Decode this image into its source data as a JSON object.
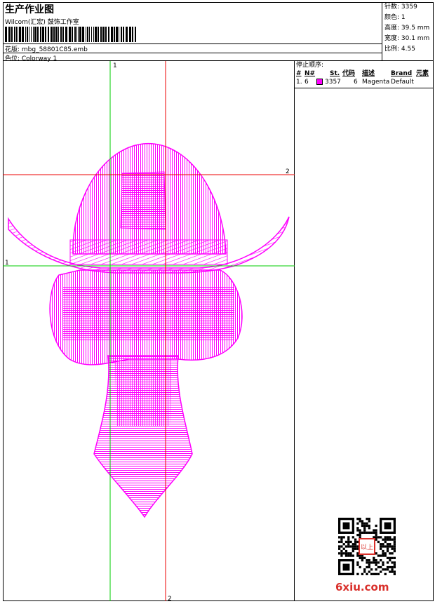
{
  "header": {
    "title": "生产作业图",
    "company": "Wilcom(汇宏) 鼓饰工作室",
    "file_line": "花版: mbg_58801C85.emb",
    "colorway_line": "色位: Colorway 1"
  },
  "stats": {
    "stitches": "针数: 3359",
    "colors": "颜色: 1",
    "height": "高度: 39.5 mm",
    "width": "宽度: 30.1 mm",
    "ratio": "比例: 4.55"
  },
  "design": {
    "marker_top": "1",
    "marker_left": "1",
    "marker_right": "2",
    "marker_bottom": "2",
    "thread_color": "#ff00ff",
    "axis_green": "#00cc00",
    "axis_red": "#ee0000"
  },
  "stop_sequence": {
    "title": "停止顺序:",
    "headers": [
      "#",
      "N#",
      "St.",
      "代码",
      "描述",
      "Brand",
      "元素"
    ],
    "rows": [
      {
        "index": "1.",
        "n": "6",
        "stitches": "3357",
        "code": "6",
        "description": "Magenta",
        "brand": "Default",
        "element": ""
      }
    ]
  },
  "watermark": {
    "text": "6xiu.com",
    "seal_text": "以上"
  }
}
